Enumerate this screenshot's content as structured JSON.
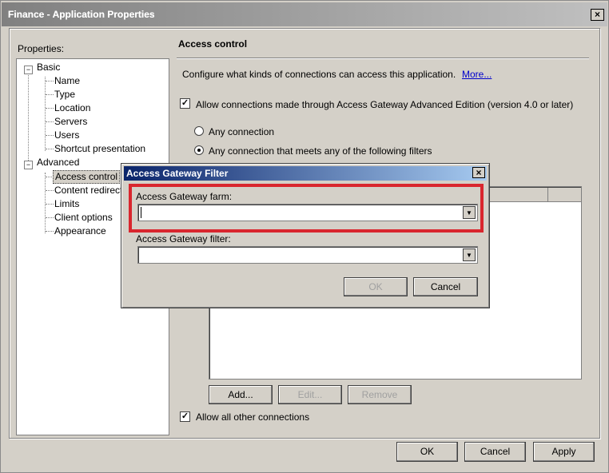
{
  "window": {
    "title": "Finance - Application Properties",
    "close_label": "×"
  },
  "properties_label": "Properties:",
  "tree": {
    "basic": "Basic",
    "basic_items": [
      "Name",
      "Type",
      "Location",
      "Servers",
      "Users",
      "Shortcut presentation"
    ],
    "advanced": "Advanced",
    "advanced_items": [
      "Access control",
      "Content redirecti",
      "Limits",
      "Client options",
      "Appearance"
    ],
    "expand_symbol": "−"
  },
  "section": {
    "title": "Access control",
    "description": "Configure what kinds of connections can access this application.",
    "more_link": "More...",
    "allow_ag_label": "Allow connections made through Access Gateway Advanced Edition (version 4.0 or later)",
    "allow_ag_checked": true,
    "radio_any": "Any connection",
    "radio_filters": "Any connection that meets any of the following filters",
    "radio_selected": "filters",
    "add_button": "Add...",
    "edit_button": "Edit...",
    "remove_button": "Remove",
    "allow_other_label": "Allow all other connections",
    "allow_other_checked": true
  },
  "footer": {
    "ok": "OK",
    "cancel": "Cancel",
    "apply": "Apply"
  },
  "dialog": {
    "title": "Access Gateway Filter",
    "close_label": "×",
    "farm_label": "Access Gateway farm:",
    "farm_value": "",
    "filter_label": "Access Gateway filter:",
    "filter_value": "",
    "ok": "OK",
    "cancel": "Cancel",
    "highlight_color": "#d9262e"
  },
  "colors": {
    "face": "#d4d0c8",
    "dialog_title_gradient_start": "#0a246a",
    "dialog_title_gradient_end": "#a6caf0"
  }
}
